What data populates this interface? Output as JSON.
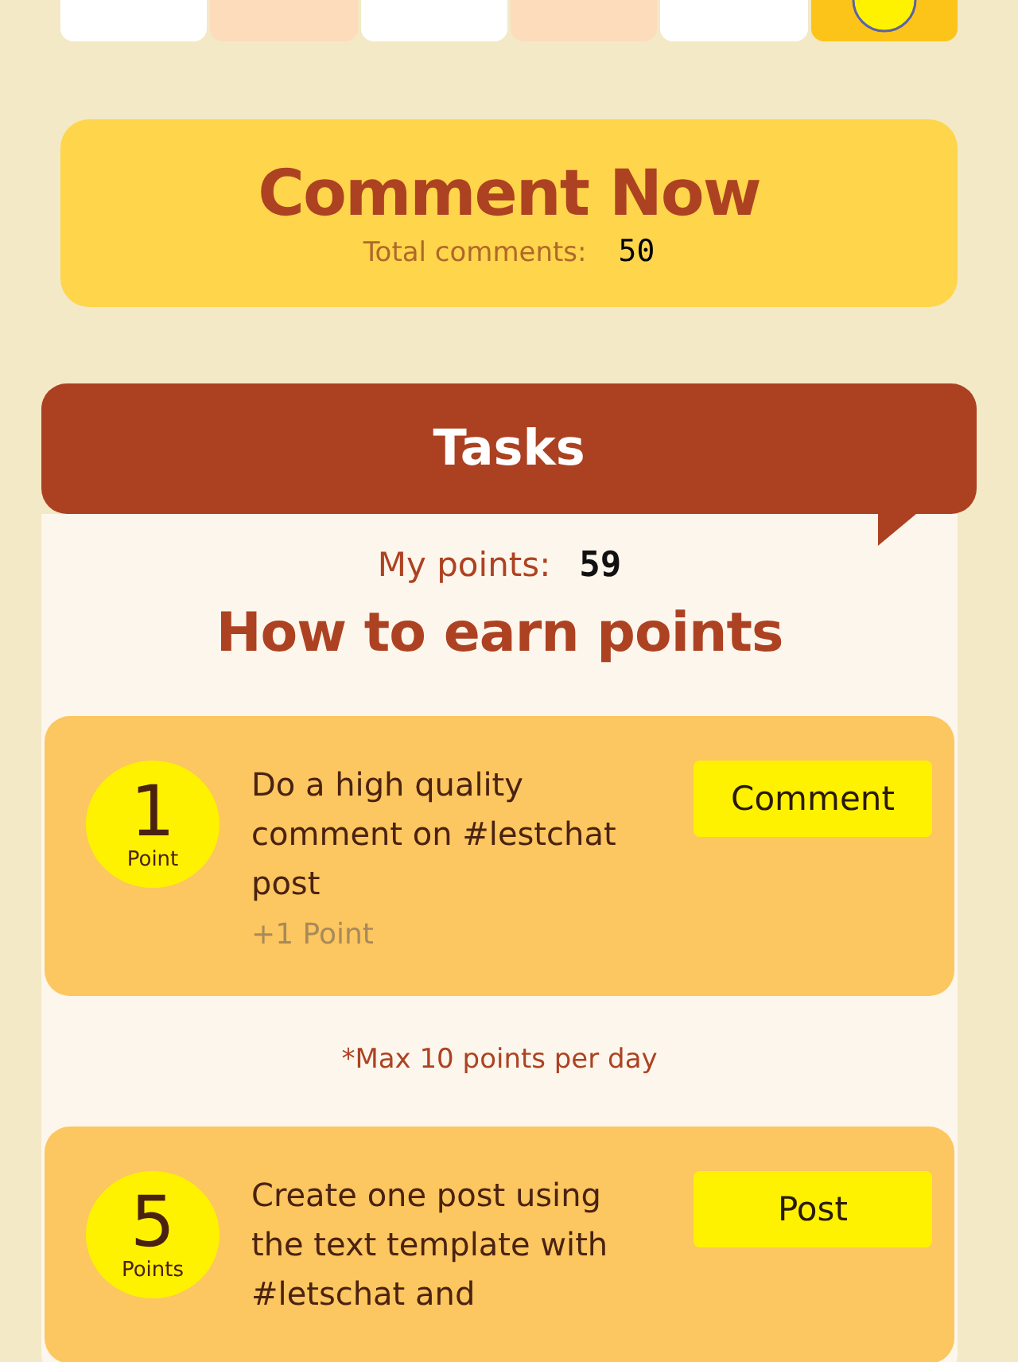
{
  "day_tiles": [
    {
      "color": "#ffffff",
      "kind": "plain"
    },
    {
      "color": "#fddcbb",
      "kind": "plain"
    },
    {
      "color": "#ffffff",
      "kind": "plain"
    },
    {
      "color": "#fddcbb",
      "kind": "plain"
    },
    {
      "color": "#ffffff",
      "kind": "plain"
    },
    {
      "color": "#fcc419",
      "kind": "circle"
    }
  ],
  "comment_card": {
    "title": "Comment Now",
    "total_label": "Total comments:",
    "total_value": "50"
  },
  "tasks": {
    "title": "Tasks",
    "points_label": "My points:",
    "points_value": "59",
    "heading": "How to earn points",
    "items": [
      {
        "points": "1",
        "unit": "Point",
        "text": "Do a high quality comment on #lestchat post",
        "reward": "+1 Point",
        "button": "Comment",
        "note": "*Max 10 points per day"
      },
      {
        "points": "5",
        "unit": "Points",
        "text": "Create one post using the text template with #letschat and",
        "button": "Post"
      }
    ]
  }
}
